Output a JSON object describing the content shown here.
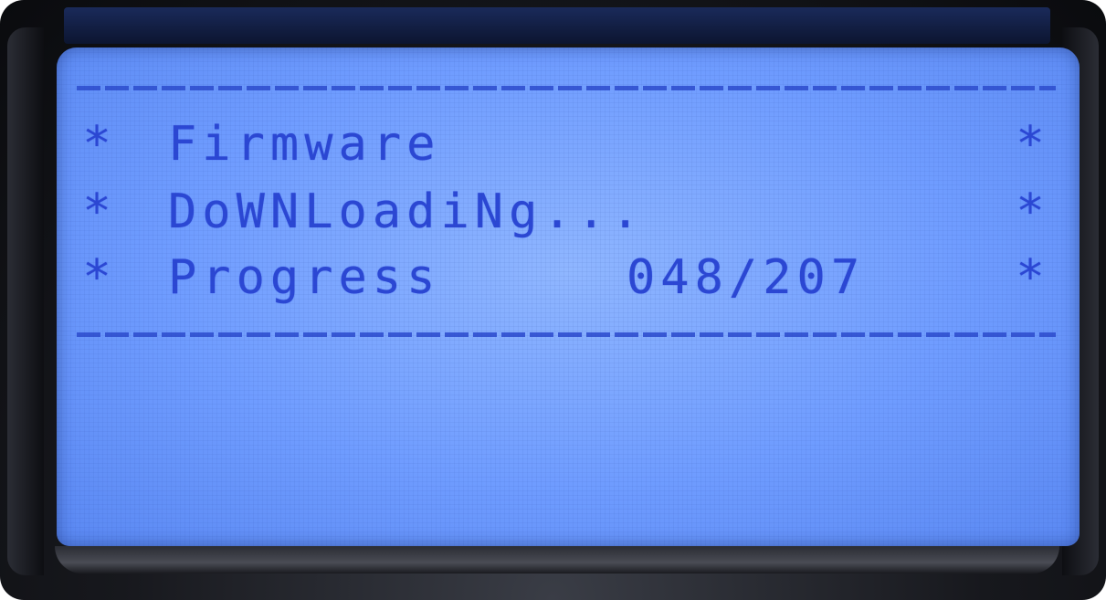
{
  "lcd": {
    "rule_top": "-----------------------------------",
    "rule_bottom": "-----------------------------------",
    "lines": [
      {
        "left": "*",
        "text": "Firmware",
        "right": "*"
      },
      {
        "left": "*",
        "text": "DoWNLoadiNg...",
        "right": "*"
      },
      {
        "left": "*",
        "text": "Progress",
        "counter": "048/207",
        "right": "*"
      }
    ]
  },
  "progress": {
    "current": 48,
    "total": 207
  },
  "colors": {
    "lcd_background": "#7aa4ff",
    "lcd_text": "#2b47d4",
    "bezel": "#141519"
  }
}
